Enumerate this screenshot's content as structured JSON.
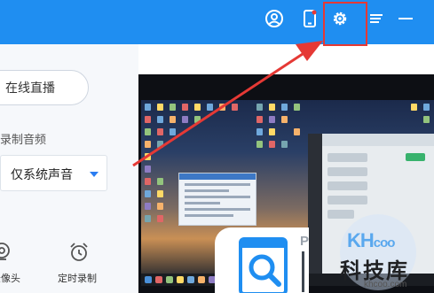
{
  "titlebar": {
    "bg_color": "#1f8ef1",
    "icons": [
      "user-icon",
      "phone-icon",
      "settings-gear-icon",
      "menu-icon",
      "minimize-icon"
    ],
    "highlight_color": "#e53935"
  },
  "panel": {
    "live_button_label": "在线直播",
    "audio_label": "录制音频",
    "audio_select_value": "仅系统声音",
    "tools": [
      {
        "label": "录像头",
        "icon": "camera-icon"
      },
      {
        "label": "定时录制",
        "icon": "alarm-clock-icon"
      }
    ]
  },
  "watermark": {
    "brand_big": "KH",
    "brand_small": "coo",
    "chinese": "科技库",
    "url": "khcoo.com"
  },
  "logo": {
    "letter": "P",
    "icon": "app-logo-icon"
  }
}
